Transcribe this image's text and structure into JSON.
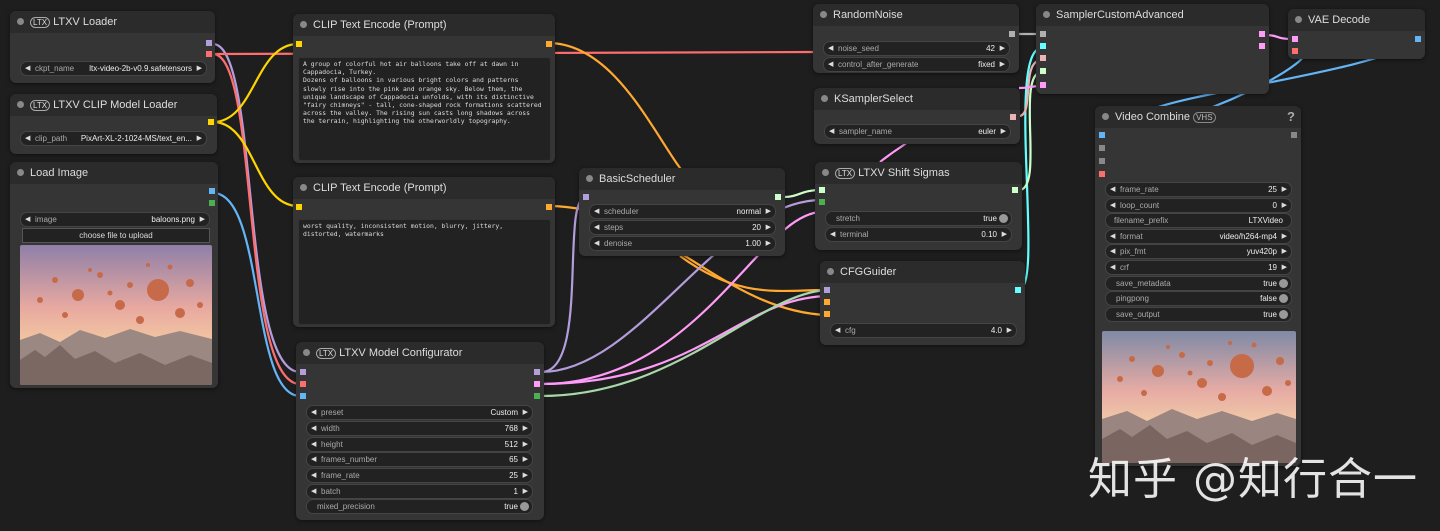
{
  "ltxv_loader": {
    "title": "LTXV Loader",
    "ckpt_label": "ckpt_name",
    "ckpt_value": "ltx-video-2b-v0.9.safetensors"
  },
  "clip_loader": {
    "title": "LTXV CLIP Model Loader",
    "clip_label": "clip_path",
    "clip_value": "PixArt-XL-2-1024-MS/text_en..."
  },
  "load_image": {
    "title": "Load Image",
    "image_label": "image",
    "image_value": "baloons.png",
    "upload_label": "choose file to upload"
  },
  "clip_pos": {
    "title": "CLIP Text Encode (Prompt)",
    "text": "A group of colorful hot air balloons take off at dawn in\nCappadocia, Turkey.\nDozens of balloons in various bright colors and patterns\nslowly rise into the pink and orange sky. Below them, the\nunique landscape of Cappadocia unfolds, with its distinctive\n\"fairy chimneys\" - tall, cone-shaped rock formations scattered\nacross the valley. The rising sun casts long shadows across\nthe terrain, highlighting the otherworldly topography."
  },
  "clip_neg": {
    "title": "CLIP Text Encode (Prompt)",
    "text": "worst quality, inconsistent motion, blurry, jittery,\ndistorted, watermarks"
  },
  "scheduler": {
    "title": "BasicScheduler",
    "widgets": [
      {
        "label": "scheduler",
        "value": "normal"
      },
      {
        "label": "steps",
        "value": "20"
      },
      {
        "label": "denoise",
        "value": "1.00"
      }
    ]
  },
  "configurator": {
    "title": "LTXV Model Configurator",
    "widgets": [
      {
        "label": "preset",
        "value": "Custom"
      },
      {
        "label": "width",
        "value": "768"
      },
      {
        "label": "height",
        "value": "512"
      },
      {
        "label": "frames_number",
        "value": "65"
      },
      {
        "label": "frame_rate",
        "value": "25"
      },
      {
        "label": "batch",
        "value": "1"
      }
    ],
    "mixed_label": "mixed_precision",
    "mixed_value": "true"
  },
  "random_noise": {
    "title": "RandomNoise",
    "widgets": [
      {
        "label": "noise_seed",
        "value": "42"
      },
      {
        "label": "control_after_generate",
        "value": "fixed"
      }
    ]
  },
  "ksampler_select": {
    "title": "KSamplerSelect",
    "label": "sampler_name",
    "value": "euler"
  },
  "shift_sigmas": {
    "title": "LTXV Shift Sigmas",
    "stretch_label": "stretch",
    "stretch_value": "true",
    "terminal_label": "terminal",
    "terminal_value": "0.10"
  },
  "cfg_guider": {
    "title": "CFGGuider",
    "label": "cfg",
    "value": "4.0"
  },
  "sampler_custom": {
    "title": "SamplerCustomAdvanced"
  },
  "vae_decode": {
    "title": "VAE Decode"
  },
  "video_combine": {
    "title": "Video Combine",
    "badge": "VHS",
    "help": "?",
    "widgets": [
      {
        "label": "frame_rate",
        "value": "25",
        "kind": "arrows"
      },
      {
        "label": "loop_count",
        "value": "0",
        "kind": "arrows"
      },
      {
        "label": "filename_prefix",
        "value": "LTXVideo",
        "kind": "plain"
      },
      {
        "label": "format",
        "value": "video/h264-mp4",
        "kind": "arrows"
      },
      {
        "label": "pix_fmt",
        "value": "yuv420p",
        "kind": "arrows"
      },
      {
        "label": "crf",
        "value": "19",
        "kind": "arrows"
      },
      {
        "label": "save_metadata",
        "value": "true",
        "kind": "toggle"
      },
      {
        "label": "pingpong",
        "value": "false",
        "kind": "toggle"
      },
      {
        "label": "save_output",
        "value": "true",
        "kind": "toggle"
      }
    ]
  },
  "ltx_badge": "LTX",
  "watermark": "知乎 @知行合一",
  "colors": {
    "model": "#b39ddb",
    "clip": "#ffd500",
    "vae": "#ff6e6e",
    "image": "#64b5f6",
    "conditioning": "#ffa931",
    "latent": "#ff9cf9",
    "sigmas": "#cdffcd",
    "noise": "#b0b0b0",
    "guider": "#66ffff",
    "sampler": "#ecb4b4"
  }
}
